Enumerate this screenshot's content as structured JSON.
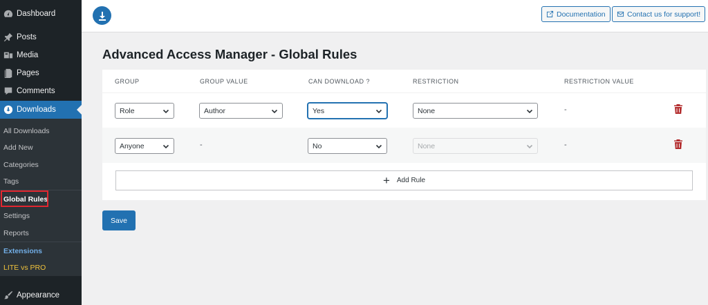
{
  "sidebar": {
    "menu": [
      {
        "label": "Dashboard",
        "icon": "dashboard-icon"
      },
      {
        "label": "Posts",
        "icon": "pin-icon"
      },
      {
        "label": "Media",
        "icon": "media-icon"
      },
      {
        "label": "Pages",
        "icon": "pages-icon"
      },
      {
        "label": "Comments",
        "icon": "comments-icon"
      },
      {
        "label": "Downloads",
        "icon": "download-icon"
      },
      {
        "label": "Appearance",
        "icon": "paintbrush-icon"
      }
    ],
    "submenu": [
      "All Downloads",
      "Add New",
      "Categories",
      "Tags",
      "Global Rules",
      "Settings",
      "Reports",
      "Extensions",
      "LITE vs PRO"
    ],
    "active_menu": "Downloads",
    "current_submenu": "Global Rules",
    "highlight_color": "#e3262f"
  },
  "header": {
    "logo_icon": "download-icon",
    "documentation_label": "Documentation",
    "support_label": "Contact us for support!"
  },
  "main": {
    "title": "Advanced Access Manager - Global Rules",
    "columns": [
      "GROUP",
      "GROUP VALUE",
      "CAN DOWNLOAD ?",
      "RESTRICTION",
      "RESTRICTION VALUE"
    ],
    "rows": [
      {
        "group": "Role",
        "group_value": "Author",
        "can_download": "Yes",
        "restriction": "None",
        "restriction_value": "-"
      },
      {
        "group": "Anyone",
        "group_value": "-",
        "can_download": "No",
        "restriction": "None",
        "restriction_value": "-"
      }
    ],
    "add_rule_label": "Add Rule",
    "save_label": "Save"
  },
  "colors": {
    "accent": "#2271b1",
    "sidebar_bg": "#1d2327",
    "delete": "#b32d2e"
  }
}
